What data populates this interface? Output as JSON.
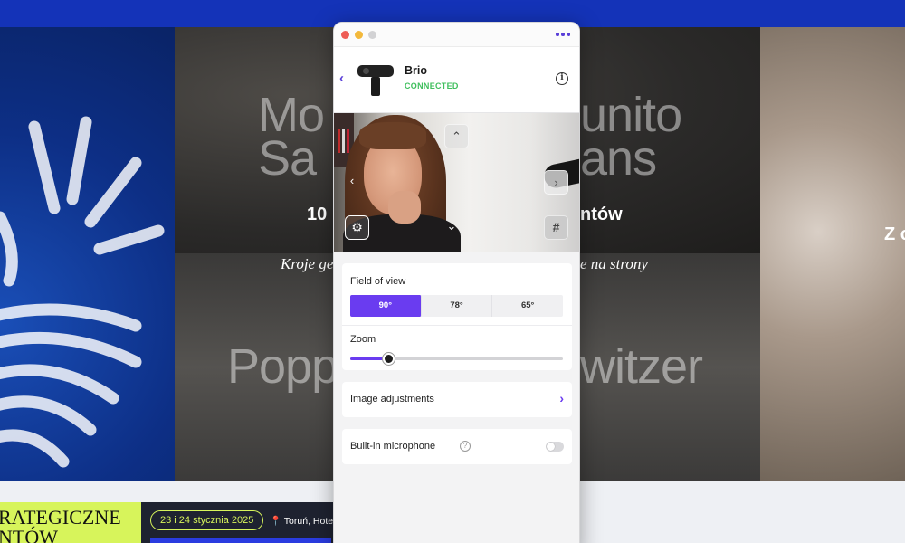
{
  "background_page": {
    "headline_top": "Mo          unito\nSa                 ans",
    "subhead_bold_left": "10",
    "subhead_bold_right": "ntów",
    "italic_left": "Kroje ge",
    "italic_right": "e na strony",
    "headline_bottom_left": "Popp",
    "headline_bottom_right": "witzer",
    "right_panel_text": "Z c",
    "lime_text_line1": "RATEGICZNE",
    "lime_text_line2": "NTÓW",
    "date_pill": "23 i 24 stycznia 2025",
    "location": "📍 Toruń, Hotel",
    "accent_blue": "#1433b8",
    "accent_lime": "#d7f45b"
  },
  "window": {
    "menu_icon": "more-dots-icon"
  },
  "device": {
    "name": "Brio",
    "status": "CONNECTED",
    "status_color": "#3fbf5d",
    "back_icon": "chevron-left-icon",
    "info_icon": "info-icon"
  },
  "preview": {
    "buttons": {
      "up": "chevron-up-icon",
      "left": "chevron-left-icon",
      "right": "chevron-right-icon",
      "down": "chevron-down-icon",
      "settings": "gear-icon",
      "grid": "grid-icon"
    }
  },
  "field_of_view": {
    "label": "Field of view",
    "options": [
      "90°",
      "78°",
      "65°"
    ],
    "selected": "90°",
    "accent": "#6a3cf0"
  },
  "zoom": {
    "label": "Zoom",
    "value_fraction": 0.18
  },
  "image_adjustments": {
    "label": "Image adjustments",
    "icon": "chevron-right-icon"
  },
  "microphone": {
    "label": "Built-in microphone",
    "help_icon": "question-icon",
    "enabled": false
  }
}
